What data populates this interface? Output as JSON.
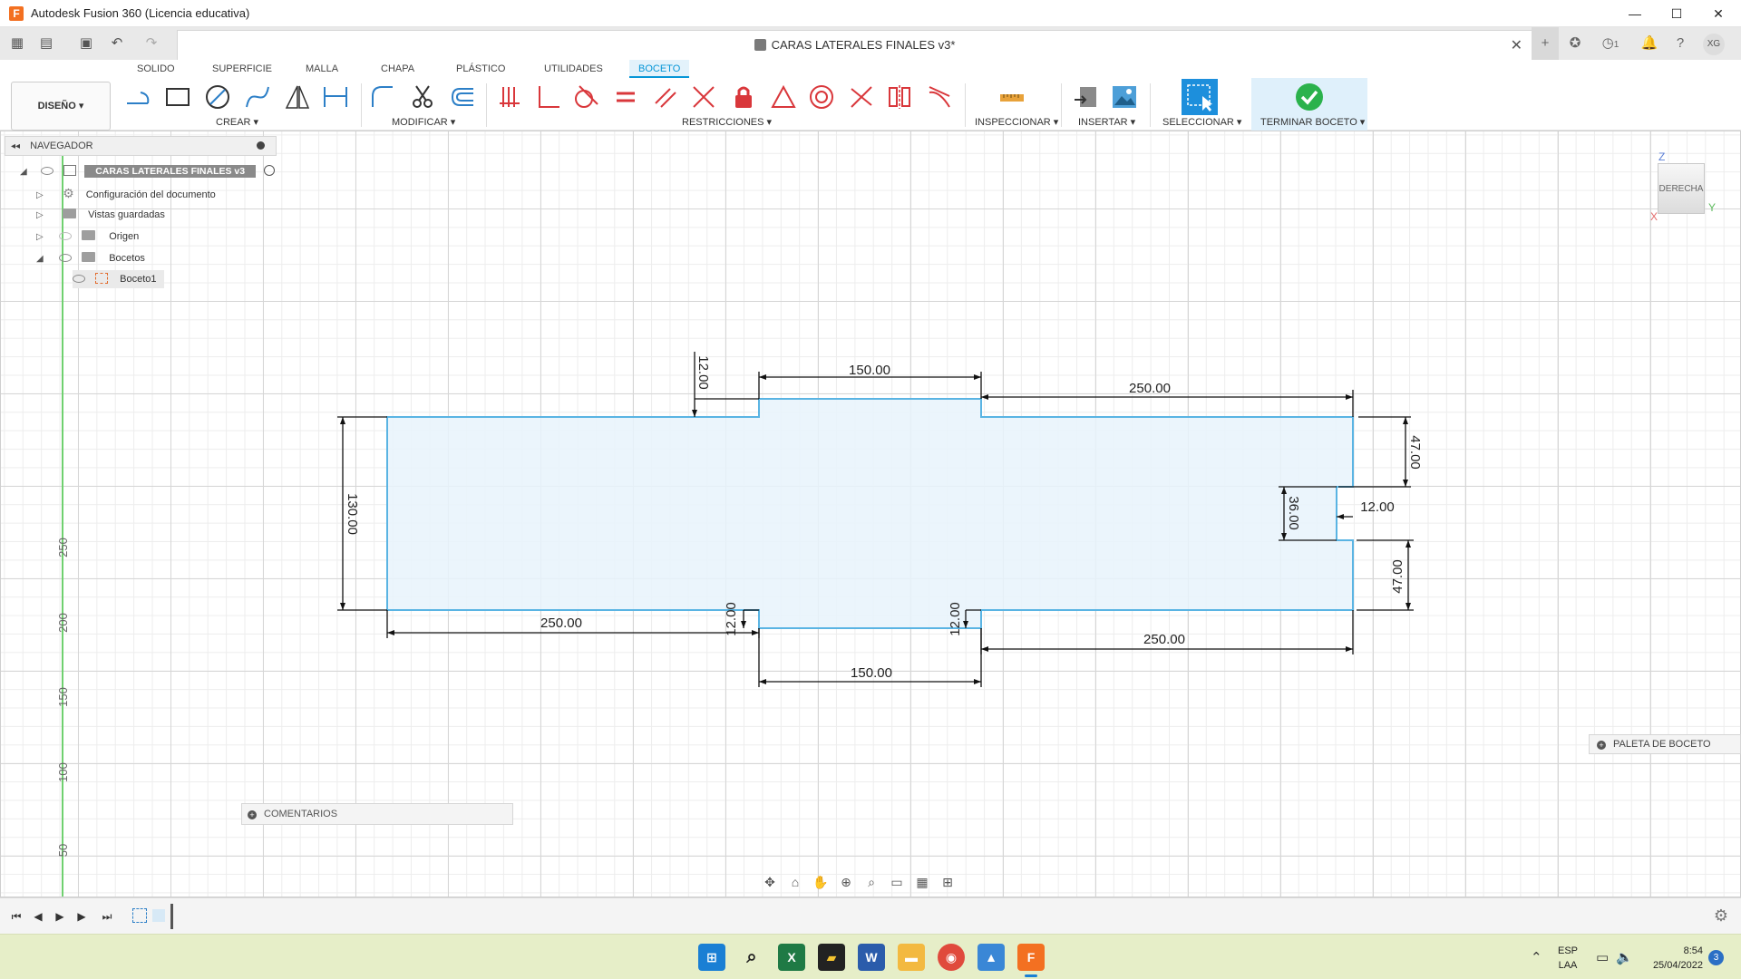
{
  "window": {
    "title": "Autodesk Fusion 360 (Licencia educativa)"
  },
  "document": {
    "name": "CARAS LATERALES FINALES v3*"
  },
  "quickbar": {
    "notifications_count": "1",
    "user_initials": "XG"
  },
  "tabs": [
    "SOLIDO",
    "SUPERFICIE",
    "MALLA",
    "CHAPA",
    "PLÁSTICO",
    "UTILIDADES",
    "BOCETO"
  ],
  "active_tab": "BOCETO",
  "ribbon": {
    "workspace": "DISEÑO ▾",
    "groups": {
      "crear": "CREAR ▾",
      "modificar": "MODIFICAR ▾",
      "restricciones": "RESTRICCIONES ▾",
      "inspeccionar": "INSPECCIONAR ▾",
      "insertar": "INSERTAR ▾",
      "seleccionar": "SELECCIONAR ▾",
      "terminar": "TERMINAR BOCETO ▾"
    }
  },
  "navigator": {
    "title": "NAVEGADOR",
    "root": "CARAS LATERALES FINALES v3",
    "items": [
      "Configuración del documento",
      "Vistas guardadas",
      "Origen",
      "Bocetos",
      "Boceto1"
    ]
  },
  "viewcube": {
    "face": "DERECHA",
    "z": "Z",
    "y": "Y",
    "x": "X"
  },
  "sketch": {
    "dimensions": {
      "top_left_step": "12.00",
      "top_center": "150.00",
      "top_right": "250.00",
      "left_height": "130.00",
      "right_top": "47.00",
      "notch_height": "36.00",
      "notch_depth": "12.00",
      "right_bottom": "47.00",
      "bottom_left": "250.00",
      "bottom_left_step": "12.00",
      "bottom_right_step": "12.00",
      "bottom_right": "250.00",
      "bottom_center": "150.00"
    },
    "ruler_labels": [
      "250",
      "200",
      "150",
      "100",
      "50"
    ]
  },
  "palette": {
    "label": "PALETA DE BOCETO"
  },
  "comments": {
    "label": "COMENTARIOS"
  },
  "taskbar": {
    "lang_top": "ESP",
    "lang_bottom": "LAA",
    "time": "8:54",
    "date": "25/04/2022",
    "notif_count": "3"
  },
  "colors": {
    "accent": "#0696d7",
    "sketch_line": "#5ab4e3",
    "sketch_fill": "#e7f3fb",
    "finish_check": "#2bb24c",
    "taskbar_bg": "#e6eec8"
  }
}
